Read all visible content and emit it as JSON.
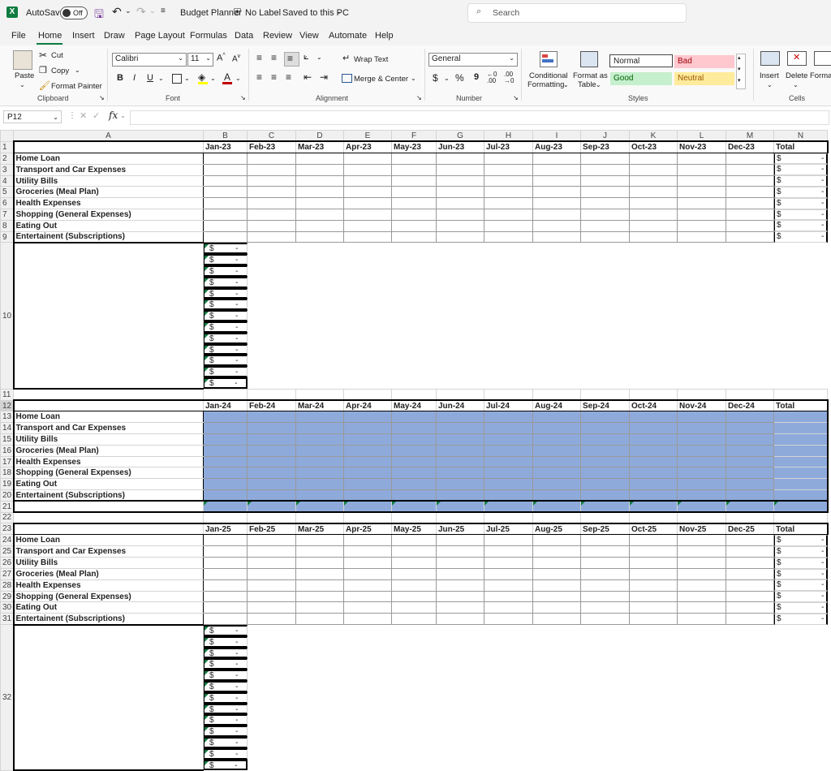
{
  "titlebar": {
    "autosave_label": "AutoSave",
    "autosave_state": "Off",
    "doc_title": "Budget Planner",
    "label_status": "No Label",
    "save_status": "Saved to this PC",
    "search_placeholder": "Search"
  },
  "menu": [
    "File",
    "Home",
    "Insert",
    "Draw",
    "Page Layout",
    "Formulas",
    "Data",
    "Review",
    "View",
    "Automate",
    "Help"
  ],
  "ribbon": {
    "clipboard": {
      "paste": "Paste",
      "cut": "Cut",
      "copy": "Copy",
      "format_painter": "Format Painter",
      "label": "Clipboard"
    },
    "font": {
      "name": "Calibri",
      "size": "11",
      "bold": "B",
      "italic": "I",
      "underline": "U",
      "label": "Font"
    },
    "alignment": {
      "wrap": "Wrap Text",
      "merge": "Merge & Center",
      "label": "Alignment"
    },
    "number": {
      "format": "General",
      "currency": "$",
      "percent": "%",
      "comma": "9",
      "label": "Number"
    },
    "styles": {
      "cond": "Conditional",
      "cond2": "Formatting",
      "fmt_table": "Format as",
      "fmt_table2": "Table",
      "normal": "Normal",
      "bad": "Bad",
      "good": "Good",
      "neutral": "Neutral",
      "label": "Styles"
    },
    "cells": {
      "insert": "Insert",
      "delete": "Delete",
      "format": "Forma",
      "label": "Cells"
    }
  },
  "formula_bar": {
    "name_box": "P12",
    "fx": "fx",
    "formula": ""
  },
  "colors": {
    "excel_green": "#107c41",
    "selection_blue": "#8eaadb",
    "bad_bg": "#ffc7ce",
    "bad_fg": "#9c0006",
    "good_bg": "#c6efce",
    "good_fg": "#006100",
    "neutral_bg": "#ffeb9c",
    "neutral_fg": "#9c5700"
  },
  "sheet": {
    "columns": [
      "A",
      "B",
      "C",
      "D",
      "E",
      "F",
      "G",
      "H",
      "I",
      "J",
      "K",
      "L",
      "M",
      "N"
    ],
    "categories": [
      "Home Loan",
      "Transport and Car Expenses",
      "Utility Bills",
      "Groceries (Meal Plan)",
      "Health Expenses",
      "Shopping (General Expenses)",
      "Eating Out",
      "Entertainent (Subscriptions)"
    ],
    "currency_symbol": "$",
    "dash": "-",
    "total_label": "Total",
    "blocks": [
      {
        "months": [
          "Jan-23",
          "Feb-23",
          "Mar-23",
          "Apr-23",
          "May-23",
          "Jun-23",
          "Jul-23",
          "Aug-23",
          "Sep-23",
          "Oct-23",
          "Nov-23",
          "Dec-23"
        ]
      },
      {
        "months": [
          "Jan-24",
          "Feb-24",
          "Mar-24",
          "Apr-24",
          "May-24",
          "Jun-24",
          "Jul-24",
          "Aug-24",
          "Sep-24",
          "Oct-24",
          "Nov-24",
          "Dec-24"
        ]
      },
      {
        "months": [
          "Jan-25",
          "Feb-25",
          "Mar-25",
          "Apr-25",
          "May-25",
          "Jun-25",
          "Jul-25",
          "Aug-25",
          "Sep-25",
          "Oct-25",
          "Nov-25",
          "Dec-25"
        ]
      }
    ]
  }
}
